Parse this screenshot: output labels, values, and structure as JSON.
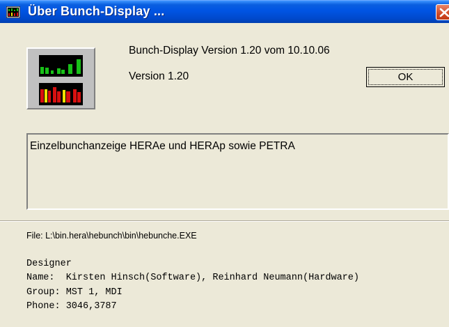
{
  "window": {
    "title": "Über Bunch-Display ...",
    "close_label": "close"
  },
  "about": {
    "version_full": "Bunch-Display Version 1.20 vom 10.10.06",
    "version": "Version 1.20",
    "ok_label": "OK",
    "description": "Einzelbunchanzeige HERAe und HERAp sowie PETRA",
    "file_path": "File: L:\\bin.hera\\hebunch\\bin\\hebunche.EXE"
  },
  "credits": {
    "line1": "Designer",
    "line2": "Name:  Kirsten Hinsch(Software), Reinhard Neumann(Hardware)",
    "line3": "Group: MST 1, MDI",
    "line4": "Phone: 3046,3787"
  },
  "colors": {
    "titlebar": "#0054e3",
    "dialog_bg": "#ece9d8",
    "close_button": "#d14a25",
    "icon_green": "#18c018",
    "icon_red": "#d81010",
    "icon_yellow": "#f0e000"
  },
  "icons": {
    "title_icon": "bunch-display-icon",
    "app_icon": "bunch-display-app-icon"
  }
}
